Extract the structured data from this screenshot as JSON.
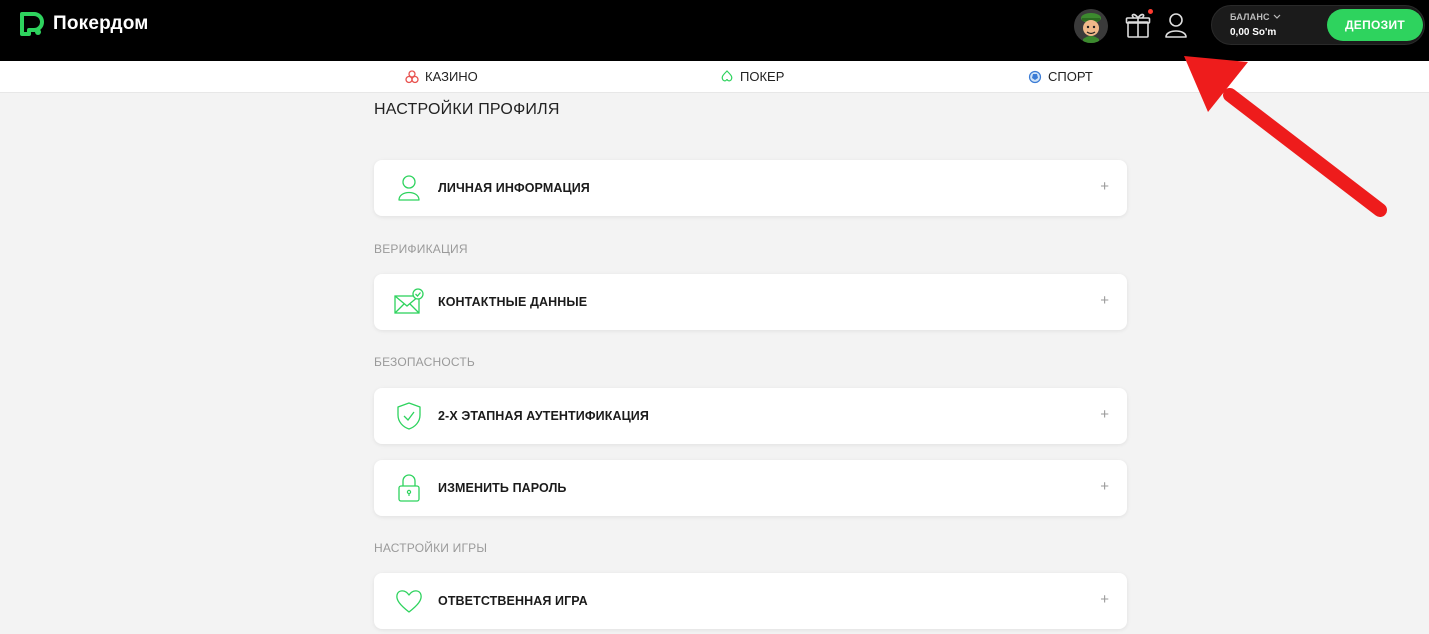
{
  "header": {
    "brand": "Покердом",
    "balance_label": "БАЛАНС",
    "balance_value": "0,00 So'm",
    "deposit_label": "ДЕПОЗИТ"
  },
  "nav": {
    "items": [
      {
        "label": "КАЗИНО",
        "icon": "casino-icon"
      },
      {
        "label": "ПОКЕР",
        "icon": "spade-icon"
      },
      {
        "label": "СПОРТ",
        "icon": "ball-icon"
      }
    ]
  },
  "page": {
    "title": "НАСТРОЙКИ ПРОФИЛЯ",
    "sections": [
      {
        "label": "",
        "items": [
          {
            "label": "ЛИЧНАЯ ИНФОРМАЦИЯ",
            "icon": "user-icon"
          }
        ]
      },
      {
        "label": "ВЕРИФИКАЦИЯ",
        "items": [
          {
            "label": "КОНТАКТНЫЕ ДАННЫЕ",
            "icon": "mail-check-icon"
          }
        ]
      },
      {
        "label": "БЕЗОПАСНОСТЬ",
        "items": [
          {
            "label": "2-Х ЭТАПНАЯ АУТЕНТИФИКАЦИЯ",
            "icon": "shield-check-icon"
          },
          {
            "label": "ИЗМЕНИТЬ ПАРОЛЬ",
            "icon": "lock-icon"
          }
        ]
      },
      {
        "label": "НАСТРОЙКИ ИГРЫ",
        "items": [
          {
            "label": "ОТВЕТСТВЕННАЯ ИГРА",
            "icon": "heart-icon"
          }
        ]
      }
    ],
    "expand_symbol": "+"
  },
  "colors": {
    "accent": "#2ed35e",
    "header_bg": "#000000",
    "page_bg": "#f3f3f3",
    "annotation_arrow": "#ee1c1c"
  }
}
